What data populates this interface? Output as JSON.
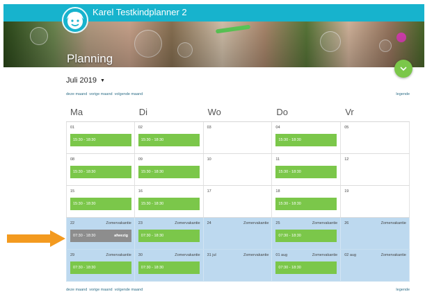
{
  "app": {
    "title": "Karel Testkindplanner 2"
  },
  "page": {
    "title": "Planning"
  },
  "month_selector": {
    "value": "Juli 2019"
  },
  "nav": {
    "prev": "deze maand",
    "today": "vorige maand",
    "next": "volgende maand",
    "legend": "legende"
  },
  "calendar": {
    "day_names": [
      "Ma",
      "Di",
      "Wo",
      "Do",
      "Vr"
    ],
    "weeks": [
      {
        "vacation": false,
        "days": [
          {
            "date": "01",
            "label": "",
            "slot": "15:30 - 18:30",
            "status": ""
          },
          {
            "date": "02",
            "label": "",
            "slot": "15:30 - 18:30",
            "status": ""
          },
          {
            "date": "03",
            "label": "",
            "slot": "",
            "status": ""
          },
          {
            "date": "04",
            "label": "",
            "slot": "15:30 - 18:30",
            "status": ""
          },
          {
            "date": "05",
            "label": "",
            "slot": "",
            "status": ""
          }
        ]
      },
      {
        "vacation": false,
        "days": [
          {
            "date": "08",
            "label": "",
            "slot": "15:30 - 18:30",
            "status": ""
          },
          {
            "date": "09",
            "label": "",
            "slot": "15:30 - 18:30",
            "status": ""
          },
          {
            "date": "10",
            "label": "",
            "slot": "",
            "status": ""
          },
          {
            "date": "11",
            "label": "",
            "slot": "15:30 - 18:30",
            "status": ""
          },
          {
            "date": "12",
            "label": "",
            "slot": "",
            "status": ""
          }
        ]
      },
      {
        "vacation": false,
        "days": [
          {
            "date": "15",
            "label": "",
            "slot": "15:30 - 18:30",
            "status": ""
          },
          {
            "date": "16",
            "label": "",
            "slot": "15:30 - 18:30",
            "status": ""
          },
          {
            "date": "17",
            "label": "",
            "slot": "",
            "status": ""
          },
          {
            "date": "18",
            "label": "",
            "slot": "15:30 - 18:30",
            "status": ""
          },
          {
            "date": "19",
            "label": "",
            "slot": "",
            "status": ""
          }
        ]
      },
      {
        "vacation": true,
        "days": [
          {
            "date": "22",
            "label": "Zomervakantie",
            "slot": "07:30 - 18:30",
            "status": "afwezig"
          },
          {
            "date": "23",
            "label": "Zomervakantie",
            "slot": "07:30 - 18:30",
            "status": ""
          },
          {
            "date": "24",
            "label": "Zomervakantie",
            "slot": "",
            "status": ""
          },
          {
            "date": "25",
            "label": "Zomervakantie",
            "slot": "07:30 - 18:30",
            "status": ""
          },
          {
            "date": "26",
            "label": "Zomervakantie",
            "slot": "",
            "status": ""
          }
        ]
      },
      {
        "vacation": true,
        "days": [
          {
            "date": "29",
            "label": "Zomervakantie",
            "slot": "07:30 - 18:30",
            "status": ""
          },
          {
            "date": "30",
            "label": "Zomervakantie",
            "slot": "07:30 - 18:30",
            "status": ""
          },
          {
            "date": "31 jul",
            "label": "Zomervakantie",
            "slot": "",
            "status": ""
          },
          {
            "date": "01 aug",
            "label": "Zomervakantie",
            "slot": "07:30 - 18:30",
            "status": ""
          },
          {
            "date": "02 aug",
            "label": "Zomervakantie",
            "slot": "",
            "status": ""
          }
        ]
      }
    ]
  },
  "colors": {
    "topbar": "#17b3cd",
    "slot": "#7bc74a",
    "absent": "#8d8d8d",
    "vacation": "#bdd9ef",
    "arrow": "#f39a1f"
  },
  "icons": {
    "avatar": "child-avatar-icon",
    "fab": "chevron-down-icon",
    "arrow": "arrow-right-icon"
  }
}
